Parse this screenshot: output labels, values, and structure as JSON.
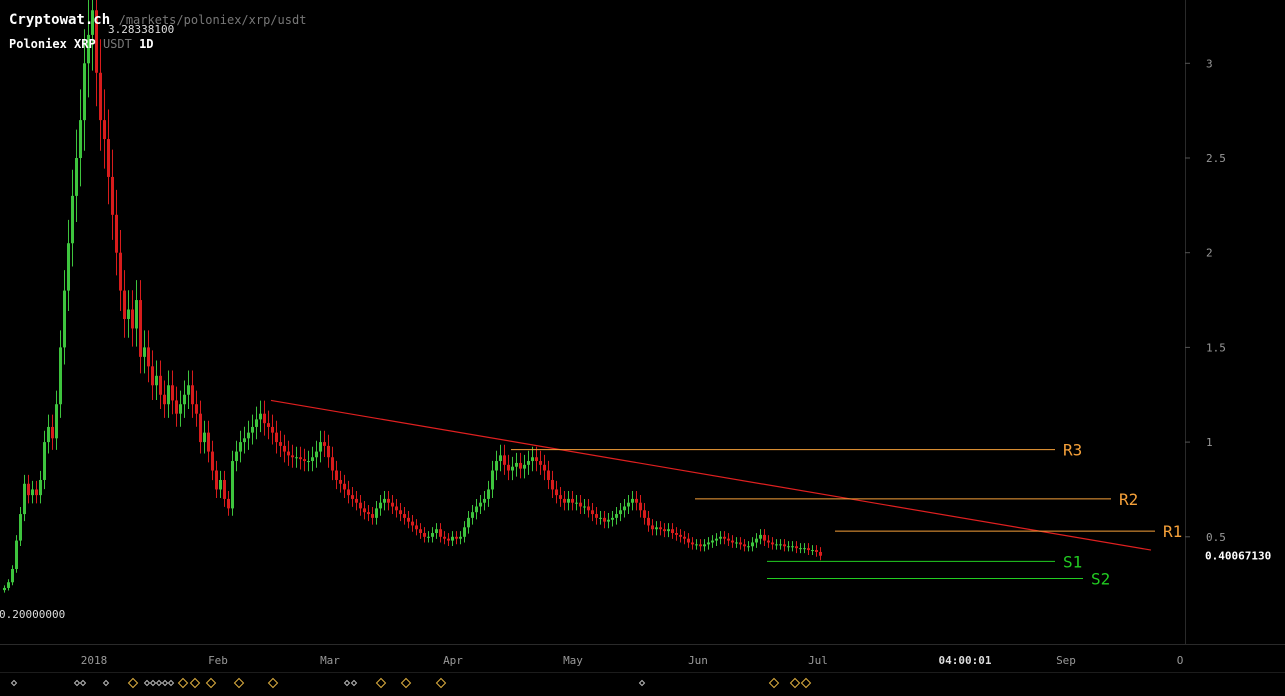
{
  "header": {
    "site": "Cryptowat.ch",
    "path": "/markets/poloniex/xrp/usdt",
    "exchange_pair": "Poloniex XRP",
    "quote": "USDT",
    "interval": "1D"
  },
  "chart_data": {
    "type": "candlestick",
    "price_axis": {
      "ticks": [
        "0.5",
        "1",
        "1.5",
        "2",
        "2.5",
        "3"
      ],
      "tick_values": [
        0.5,
        1,
        1.5,
        2,
        2.5,
        3
      ],
      "ylim": [
        0,
        3.3
      ]
    },
    "time_axis": {
      "ticks": [
        "2018",
        "Feb",
        "Mar",
        "Apr",
        "May",
        "Jun",
        "Jul",
        "04:00:01",
        "Sep",
        "O"
      ],
      "xlim": [
        "2017-12-12",
        "2018-10-01"
      ]
    },
    "max_label": "3.28338100",
    "min_label": "0.20000000",
    "last_price_label": "0.40067130",
    "close_series": {
      "start": "2017-12-12",
      "closes": [
        0.23,
        0.26,
        0.33,
        0.48,
        0.62,
        0.78,
        0.72,
        0.75,
        0.72,
        0.8,
        1.0,
        1.08,
        1.02,
        1.2,
        1.5,
        1.8,
        2.05,
        2.3,
        2.5,
        2.7,
        3.0,
        3.15,
        3.28,
        2.95,
        2.7,
        2.6,
        2.4,
        2.2,
        2.0,
        1.8,
        1.65,
        1.7,
        1.6,
        1.75,
        1.45,
        1.5,
        1.4,
        1.3,
        1.35,
        1.25,
        1.2,
        1.3,
        1.22,
        1.15,
        1.2,
        1.25,
        1.3,
        1.2,
        1.15,
        1.0,
        1.05,
        0.95,
        0.85,
        0.75,
        0.8,
        0.7,
        0.65,
        0.9,
        0.95,
        1.0,
        1.02,
        1.05,
        1.08,
        1.12,
        1.15,
        1.1,
        1.08,
        1.05,
        1.0,
        0.98,
        0.95,
        0.93,
        0.92,
        0.92,
        0.91,
        0.9,
        0.9,
        0.92,
        0.95,
        1.0,
        0.98,
        0.92,
        0.85,
        0.8,
        0.78,
        0.75,
        0.72,
        0.7,
        0.68,
        0.65,
        0.63,
        0.62,
        0.6,
        0.65,
        0.68,
        0.7,
        0.68,
        0.66,
        0.64,
        0.62,
        0.6,
        0.58,
        0.56,
        0.54,
        0.52,
        0.5,
        0.5,
        0.52,
        0.54,
        0.5,
        0.49,
        0.48,
        0.5,
        0.49,
        0.5,
        0.55,
        0.6,
        0.63,
        0.66,
        0.68,
        0.7,
        0.75,
        0.85,
        0.9,
        0.93,
        0.88,
        0.85,
        0.87,
        0.89,
        0.86,
        0.88,
        0.9,
        0.92,
        0.9,
        0.88,
        0.85,
        0.8,
        0.75,
        0.72,
        0.7,
        0.68,
        0.7,
        0.68,
        0.68,
        0.66,
        0.66,
        0.64,
        0.62,
        0.6,
        0.6,
        0.58,
        0.59,
        0.6,
        0.62,
        0.64,
        0.66,
        0.68,
        0.7,
        0.68,
        0.64,
        0.6,
        0.56,
        0.54,
        0.55,
        0.54,
        0.53,
        0.54,
        0.52,
        0.51,
        0.5,
        0.49,
        0.47,
        0.46,
        0.46,
        0.45,
        0.46,
        0.47,
        0.48,
        0.49,
        0.5,
        0.49,
        0.48,
        0.47,
        0.47,
        0.46,
        0.45,
        0.45,
        0.47,
        0.49,
        0.51,
        0.48,
        0.47,
        0.46,
        0.46,
        0.46,
        0.45,
        0.45,
        0.45,
        0.44,
        0.44,
        0.44,
        0.43,
        0.43,
        0.42,
        0.4
      ]
    },
    "trendline": {
      "from": {
        "date": "2018-02-17",
        "price": 1.22
      },
      "to": {
        "date": "2018-09-25",
        "price": 0.43
      }
    },
    "levels": [
      {
        "name": "R3",
        "price": 0.96,
        "from": "2018-04-18",
        "to": "2018-09-01",
        "color": "#f6a13a"
      },
      {
        "name": "R2",
        "price": 0.7,
        "from": "2018-06-03",
        "to": "2018-09-15",
        "color": "#f6a13a"
      },
      {
        "name": "R1",
        "price": 0.53,
        "from": "2018-07-08",
        "to": "2018-09-26",
        "color": "#f6a13a"
      },
      {
        "name": "S1",
        "price": 0.37,
        "from": "2018-06-21",
        "to": "2018-09-01",
        "color": "#22cc22"
      },
      {
        "name": "S2",
        "price": 0.28,
        "from": "2018-06-21",
        "to": "2018-09-08",
        "color": "#22cc22"
      }
    ],
    "colors": {
      "up": "#3ec43e",
      "down": "#d81c1c",
      "trend": "#e02020",
      "marker": "#e0b040",
      "grid": "#1e1e1e"
    }
  }
}
